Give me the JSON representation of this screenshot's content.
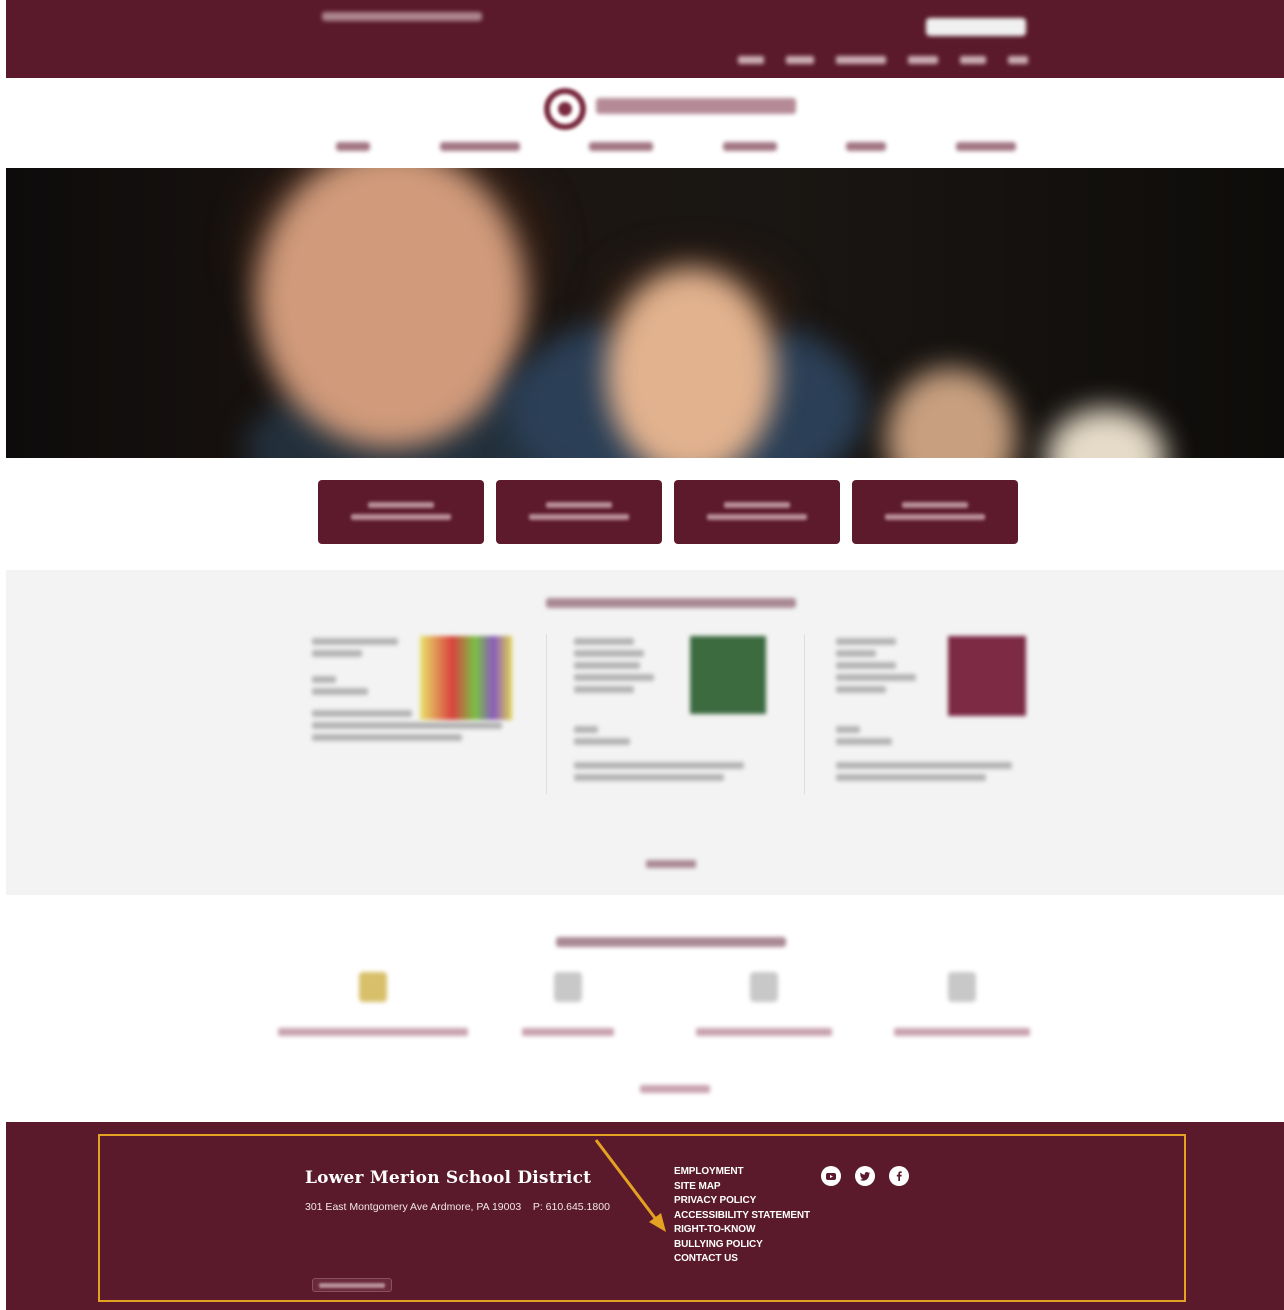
{
  "footer": {
    "district_name": "Lower Merion School District",
    "address": "301 East Montgomery Ave Ardmore, PA 19003",
    "phone": "P: 610.645.1800",
    "links": [
      "EMPLOYMENT",
      "SITE MAP",
      "PRIVACY POLICY",
      "ACCESSIBILITY STATEMENT",
      "RIGHT-TO-KNOW",
      "BULLYING POLICY",
      "CONTACT US"
    ],
    "social_icons": [
      "youtube-icon",
      "twitter-icon",
      "facebook-icon"
    ]
  },
  "colors": {
    "brand_maroon": "#5a1a2b",
    "highlight": "#e4a122",
    "news_bg": "#f3f3f3"
  }
}
